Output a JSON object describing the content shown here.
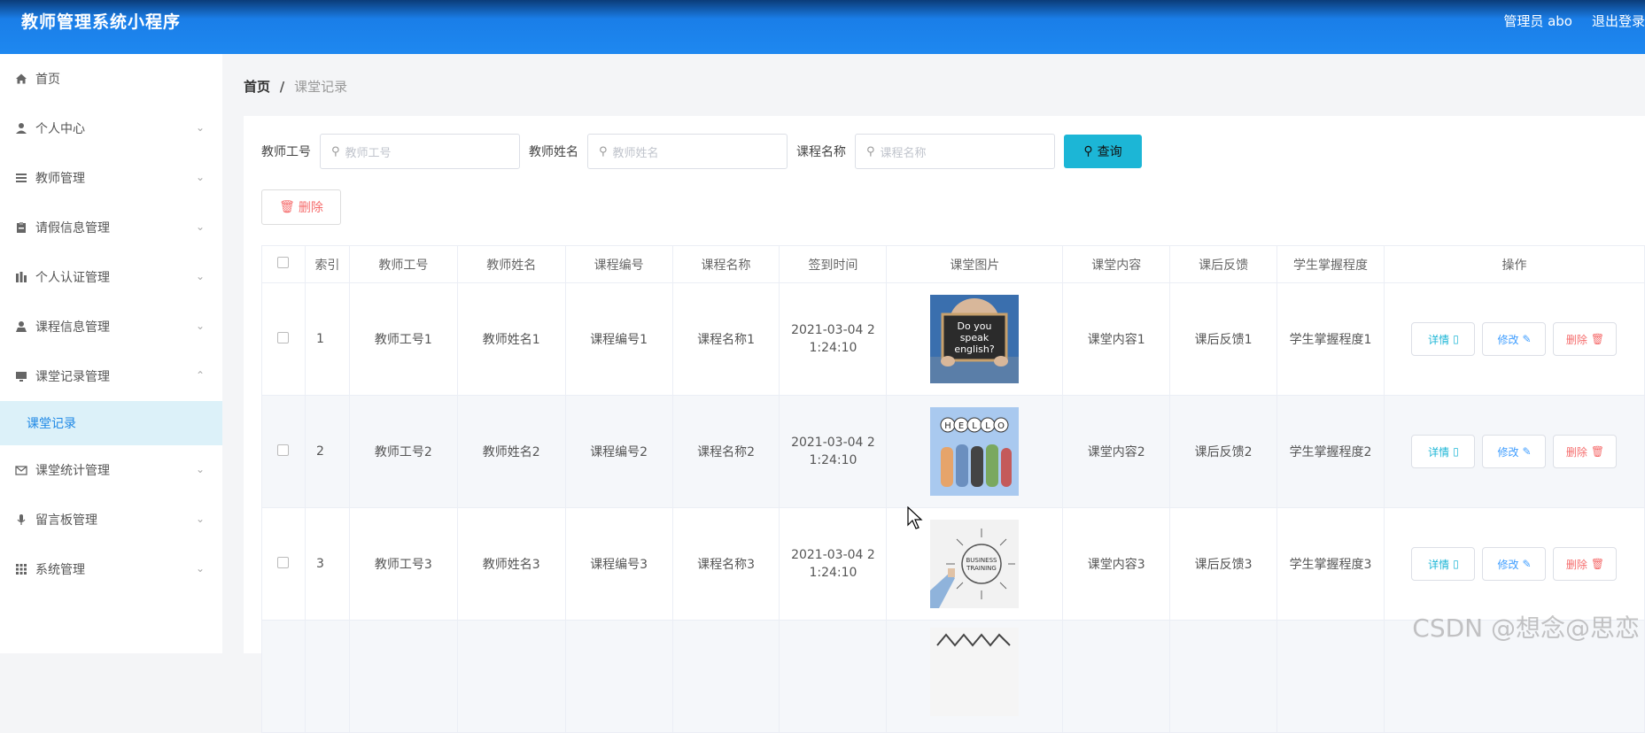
{
  "header": {
    "app_title": "教师管理系统小程序",
    "user_label": "管理员 abo",
    "logout_label": "退出登录"
  },
  "sidebar": {
    "items": [
      {
        "label": "首页",
        "icon": "home-icon"
      },
      {
        "label": "个人中心",
        "icon": "user-icon"
      },
      {
        "label": "教师管理",
        "icon": "list-icon"
      },
      {
        "label": "请假信息管理",
        "icon": "clipboard-icon"
      },
      {
        "label": "个人认证管理",
        "icon": "chart-bars-icon"
      },
      {
        "label": "课程信息管理",
        "icon": "user-tie-icon"
      },
      {
        "label": "课堂记录管理",
        "icon": "monitor-icon"
      },
      {
        "label": "课堂记录",
        "icon": ""
      },
      {
        "label": "课堂统计管理",
        "icon": "mail-icon"
      },
      {
        "label": "留言板管理",
        "icon": "mic-icon"
      },
      {
        "label": "系统管理",
        "icon": "grid-icon"
      }
    ]
  },
  "breadcrumb": {
    "home": "首页",
    "separator": "/",
    "current": "课堂记录"
  },
  "search": {
    "teacher_id_label": "教师工号",
    "teacher_id_placeholder": "教师工号",
    "teacher_name_label": "教师姓名",
    "teacher_name_placeholder": "教师姓名",
    "course_name_label": "课程名称",
    "course_name_placeholder": "课程名称",
    "query_label": "查询"
  },
  "toolbar": {
    "delete_label": "删除"
  },
  "table": {
    "columns": [
      "索引",
      "教师工号",
      "教师姓名",
      "课程编号",
      "课程名称",
      "签到时间",
      "课堂图片",
      "课堂内容",
      "课后反馈",
      "学生掌握程度",
      "操作"
    ],
    "rows": [
      {
        "index": "1",
        "teacher_id": "教师工号1",
        "teacher_name": "教师姓名1",
        "course_no": "课程编号1",
        "course_name": "课程名称1",
        "signin_a": "2021-03-04 2",
        "signin_b": "1:24:10",
        "image_text": "Do you speak english?",
        "content": "课堂内容1",
        "feedback": "课后反馈1",
        "mastery": "学生掌握程度1"
      },
      {
        "index": "2",
        "teacher_id": "教师工号2",
        "teacher_name": "教师姓名2",
        "course_no": "课程编号2",
        "course_name": "课程名称2",
        "signin_a": "2021-03-04 2",
        "signin_b": "1:24:10",
        "image_text": "HELLO",
        "content": "课堂内容2",
        "feedback": "课后反馈2",
        "mastery": "学生掌握程度2"
      },
      {
        "index": "3",
        "teacher_id": "教师工号3",
        "teacher_name": "教师姓名3",
        "course_no": "课程编号3",
        "course_name": "课程名称3",
        "signin_a": "2021-03-04 2",
        "signin_b": "1:24:10",
        "image_text": "BUSINESS TRAINING",
        "content": "课堂内容3",
        "feedback": "课后反馈3",
        "mastery": "学生掌握程度3"
      }
    ],
    "actions": {
      "detail": "详情",
      "edit": "修改",
      "delete": "删除"
    }
  },
  "watermark": "CSDN @想念@思恋"
}
